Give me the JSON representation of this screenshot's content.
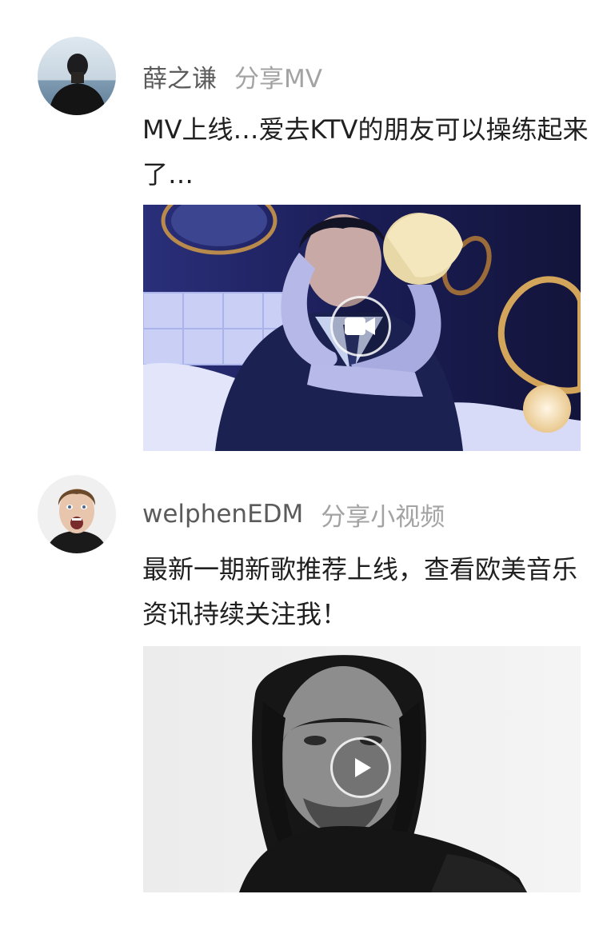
{
  "posts": [
    {
      "username": "薛之谦",
      "action": "分享MV",
      "text": "MV上线…爱去KTV的朋友可以操练起来了…",
      "media_type": "video-camera-icon"
    },
    {
      "username": "welphenEDM",
      "action": "分享小视频",
      "text": "最新一期新歌推荐上线，查看欧美音乐资讯持续关注我！",
      "media_type": "play-icon"
    }
  ],
  "colors": {
    "username": "#5b5b5b",
    "action": "#a3a3a3",
    "body_text": "#202020",
    "background": "#ffffff"
  }
}
